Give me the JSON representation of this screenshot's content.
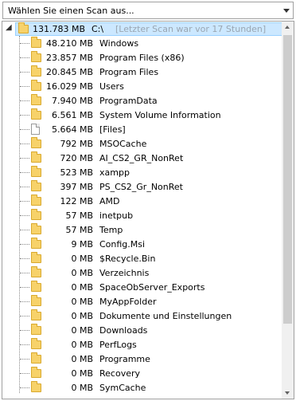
{
  "dropdown": {
    "label": "Wählen Sie einen Scan aus..."
  },
  "root": {
    "size": "131.783 MB",
    "path": "C:\\",
    "note": "[Letzter Scan war vor 17 Stunden]"
  },
  "items": [
    {
      "size": "48.210 MB",
      "name": "Windows",
      "type": "folder",
      "expandable": true
    },
    {
      "size": "23.857 MB",
      "name": "Program Files (x86)",
      "type": "folder",
      "expandable": true
    },
    {
      "size": "20.845 MB",
      "name": "Program Files",
      "type": "folder",
      "expandable": true
    },
    {
      "size": "16.029 MB",
      "name": "Users",
      "type": "folder",
      "expandable": true
    },
    {
      "size": "7.940 MB",
      "name": "ProgramData",
      "type": "folder",
      "expandable": true
    },
    {
      "size": "6.561 MB",
      "name": "System Volume Information",
      "type": "folder",
      "expandable": true
    },
    {
      "size": "5.664 MB",
      "name": "[Files]",
      "type": "file",
      "expandable": false
    },
    {
      "size": "792 MB",
      "name": "MSOCache",
      "type": "folder",
      "expandable": true
    },
    {
      "size": "720 MB",
      "name": "AI_CS2_GR_NonRet",
      "type": "folder",
      "expandable": true
    },
    {
      "size": "523 MB",
      "name": "xampp",
      "type": "folder",
      "expandable": true
    },
    {
      "size": "397 MB",
      "name": "PS_CS2_Gr_NonRet",
      "type": "folder",
      "expandable": true
    },
    {
      "size": "122 MB",
      "name": "AMD",
      "type": "folder",
      "expandable": true
    },
    {
      "size": "57 MB",
      "name": "inetpub",
      "type": "folder",
      "expandable": true
    },
    {
      "size": "57 MB",
      "name": "Temp",
      "type": "folder",
      "expandable": true
    },
    {
      "size": "9 MB",
      "name": "Config.Msi",
      "type": "folder",
      "expandable": false
    },
    {
      "size": "0 MB",
      "name": "$Recycle.Bin",
      "type": "folder",
      "expandable": true
    },
    {
      "size": "0 MB",
      "name": "Verzeichnis",
      "type": "folder",
      "expandable": false
    },
    {
      "size": "0 MB",
      "name": "SpaceObServer_Exports",
      "type": "folder",
      "expandable": false
    },
    {
      "size": "0 MB",
      "name": "MyAppFolder",
      "type": "folder",
      "expandable": false
    },
    {
      "size": "0 MB",
      "name": "Dokumente und Einstellungen",
      "type": "folder",
      "expandable": false
    },
    {
      "size": "0 MB",
      "name": "Downloads",
      "type": "folder",
      "expandable": false
    },
    {
      "size": "0 MB",
      "name": "PerfLogs",
      "type": "folder",
      "expandable": false
    },
    {
      "size": "0 MB",
      "name": "Programme",
      "type": "folder",
      "expandable": false
    },
    {
      "size": "0 MB",
      "name": "Recovery",
      "type": "folder",
      "expandable": false
    },
    {
      "size": "0 MB",
      "name": "SymCache",
      "type": "folder",
      "expandable": false
    }
  ],
  "colors": {
    "selection": "#cce8ff",
    "folder": "#f7d26a",
    "note": "#9aa6b2"
  }
}
